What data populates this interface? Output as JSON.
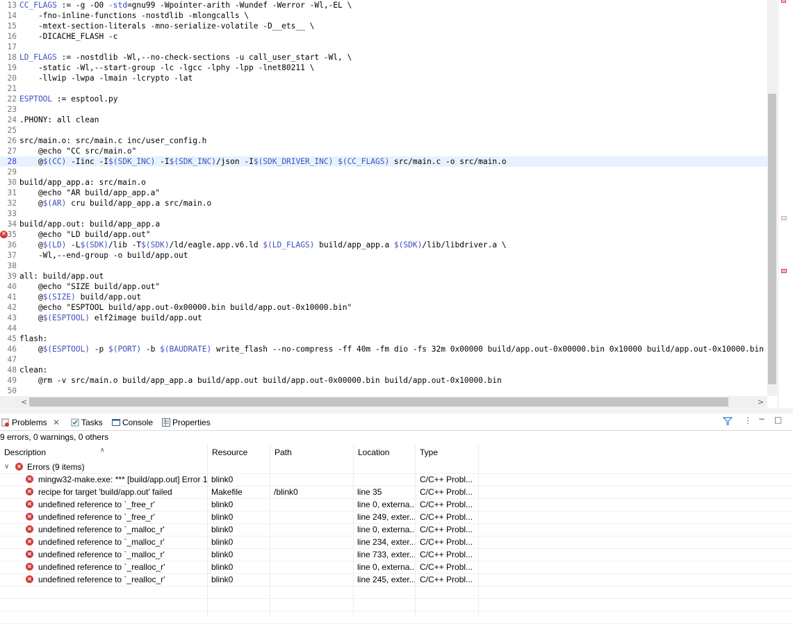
{
  "editor": {
    "lines": [
      {
        "n": "13",
        "segs": [
          [
            "kw",
            "CC_FLAGS"
          ],
          [
            "",
            " := -g -O0 "
          ],
          [
            "kw",
            "-std"
          ],
          [
            "",
            "=gnu99 -Wpointer-arith -Wundef -Werror -Wl,-EL \\"
          ]
        ]
      },
      {
        "n": "14",
        "segs": [
          [
            "",
            "    -fno-inline-functions -nostdlib -mlongcalls \\"
          ]
        ]
      },
      {
        "n": "15",
        "segs": [
          [
            "",
            "    -mtext-section-literals -mno-serialize-volatile -D__ets__ \\"
          ]
        ]
      },
      {
        "n": "16",
        "segs": [
          [
            "",
            "    -DICACHE_FLASH -c"
          ]
        ]
      },
      {
        "n": "17",
        "segs": [
          [
            "",
            ""
          ]
        ]
      },
      {
        "n": "18",
        "segs": [
          [
            "kw",
            "LD_FLAGS"
          ],
          [
            "",
            " := -nostdlib -Wl,--no-check-sections -u call_user_start -Wl, \\"
          ]
        ]
      },
      {
        "n": "19",
        "segs": [
          [
            "",
            "    -static -Wl,--start-group -lc -lgcc -lphy -lpp -lnet80211 \\"
          ]
        ]
      },
      {
        "n": "20",
        "segs": [
          [
            "",
            "    -llwip -lwpa -lmain -lcrypto -lat"
          ]
        ]
      },
      {
        "n": "21",
        "segs": [
          [
            "",
            ""
          ]
        ]
      },
      {
        "n": "22",
        "segs": [
          [
            "kw",
            "ESPTOOL"
          ],
          [
            "",
            " := esptool.py"
          ]
        ]
      },
      {
        "n": "23",
        "segs": [
          [
            "",
            ""
          ]
        ]
      },
      {
        "n": "24",
        "segs": [
          [
            "",
            ".PHONY: all clean"
          ]
        ]
      },
      {
        "n": "25",
        "segs": [
          [
            "",
            ""
          ]
        ]
      },
      {
        "n": "26",
        "segs": [
          [
            "",
            "src/main.o: src/main.c inc/user_config.h"
          ]
        ]
      },
      {
        "n": "27",
        "segs": [
          [
            "",
            "    @echo \"CC src/main.o\""
          ]
        ]
      },
      {
        "n": "28",
        "segs": [
          [
            "",
            "    @"
          ],
          [
            "kw",
            "$(CC)"
          ],
          [
            "",
            " -Iinc -I"
          ],
          [
            "kw",
            "$(SDK_INC)"
          ],
          [
            "",
            " -I"
          ],
          [
            "kw",
            "$(SDK_INC)"
          ],
          [
            "",
            "/json -I"
          ],
          [
            "kw",
            "$(SDK_DRIVER_INC)"
          ],
          [
            "",
            " "
          ],
          [
            "kw",
            "$(CC_FLAGS)"
          ],
          [
            "",
            " src/main.c -o src/main.o"
          ]
        ]
      },
      {
        "n": "29",
        "segs": [
          [
            "",
            ""
          ]
        ]
      },
      {
        "n": "30",
        "segs": [
          [
            "",
            "build/app_app.a: src/main.o"
          ]
        ]
      },
      {
        "n": "31",
        "segs": [
          [
            "",
            "    @echo \"AR build/app_app.a\""
          ]
        ]
      },
      {
        "n": "32",
        "segs": [
          [
            "",
            "    @"
          ],
          [
            "kw",
            "$(AR)"
          ],
          [
            "",
            " cru build/app_app.a src/main.o"
          ]
        ]
      },
      {
        "n": "33",
        "segs": [
          [
            "",
            ""
          ]
        ]
      },
      {
        "n": "34",
        "segs": [
          [
            "",
            "build/app.out: build/app_app.a"
          ]
        ]
      },
      {
        "n": "35",
        "segs": [
          [
            "",
            "    @echo \"LD build/app.out\""
          ]
        ]
      },
      {
        "n": "36",
        "segs": [
          [
            "",
            "    @"
          ],
          [
            "kw",
            "$(LD)"
          ],
          [
            "",
            " -L"
          ],
          [
            "kw",
            "$(SDK)"
          ],
          [
            "",
            "/lib -T"
          ],
          [
            "kw",
            "$(SDK)"
          ],
          [
            "",
            "/ld/eagle.app.v6.ld "
          ],
          [
            "kw",
            "$(LD_FLAGS)"
          ],
          [
            "",
            " build/app_app.a "
          ],
          [
            "kw",
            "$(SDK)"
          ],
          [
            "",
            "/lib/libdriver.a \\"
          ]
        ]
      },
      {
        "n": "37",
        "segs": [
          [
            "",
            "    -Wl,--end-group -o build/app.out"
          ]
        ]
      },
      {
        "n": "38",
        "segs": [
          [
            "",
            ""
          ]
        ]
      },
      {
        "n": "39",
        "segs": [
          [
            "",
            "all: build/app.out"
          ]
        ]
      },
      {
        "n": "40",
        "segs": [
          [
            "",
            "    @echo \"SIZE build/app.out\""
          ]
        ]
      },
      {
        "n": "41",
        "segs": [
          [
            "",
            "    @"
          ],
          [
            "kw",
            "$(SIZE)"
          ],
          [
            "",
            " build/app.out"
          ]
        ]
      },
      {
        "n": "42",
        "segs": [
          [
            "",
            "    @echo \"ESPTOOL build/app.out-0x00000.bin build/app.out-0x10000.bin\""
          ]
        ]
      },
      {
        "n": "43",
        "segs": [
          [
            "",
            "    @"
          ],
          [
            "kw",
            "$(ESPTOOL)"
          ],
          [
            "",
            " elf2image build/app.out"
          ]
        ]
      },
      {
        "n": "44",
        "segs": [
          [
            "",
            ""
          ]
        ]
      },
      {
        "n": "45",
        "segs": [
          [
            "",
            "flash:"
          ]
        ]
      },
      {
        "n": "46",
        "segs": [
          [
            "",
            "    @"
          ],
          [
            "kw",
            "$(ESPTOOL)"
          ],
          [
            "",
            " -p "
          ],
          [
            "kw",
            "$(PORT)"
          ],
          [
            "",
            " -b "
          ],
          [
            "kw",
            "$(BAUDRATE)"
          ],
          [
            "",
            " write_flash --no-compress -ff 40m -fm dio -fs 32m 0x00000 build/app.out-0x00000.bin 0x10000 build/app.out-0x10000.bin"
          ]
        ]
      },
      {
        "n": "47",
        "segs": [
          [
            "",
            ""
          ]
        ]
      },
      {
        "n": "48",
        "segs": [
          [
            "",
            "clean:"
          ]
        ]
      },
      {
        "n": "49",
        "segs": [
          [
            "",
            "    @rm -v src/main.o build/app_app.a build/app.out build/app.out-0x00000.bin build/app.out-0x10000.bin"
          ]
        ]
      },
      {
        "n": "50",
        "segs": [
          [
            "",
            ""
          ]
        ]
      }
    ],
    "current_line": "28",
    "error_line": "35"
  },
  "panel": {
    "tabs": [
      {
        "label": "Problems",
        "icon": "problems-icon"
      },
      {
        "label": "Tasks",
        "icon": "tasks-icon"
      },
      {
        "label": "Console",
        "icon": "console-icon"
      },
      {
        "label": "Properties",
        "icon": "properties-icon"
      }
    ],
    "summary": "9 errors, 0 warnings, 0 others",
    "columns": [
      "Description",
      "Resource",
      "Path",
      "Location",
      "Type"
    ],
    "group_label": "Errors (9 items)",
    "rows": [
      [
        "mingw32-make.exe: *** [build/app.out] Error 1",
        "blink0",
        "",
        "",
        "C/C++ Probl..."
      ],
      [
        "recipe for target 'build/app.out' failed",
        "Makefile",
        "/blink0",
        "line 35",
        "C/C++ Probl..."
      ],
      [
        "undefined reference to `_free_r'",
        "blink0",
        "",
        "line 0, externa...",
        "C/C++ Probl..."
      ],
      [
        "undefined reference to `_free_r'",
        "blink0",
        "",
        "line 249, exter...",
        "C/C++ Probl..."
      ],
      [
        "undefined reference to `_malloc_r'",
        "blink0",
        "",
        "line 0, externa...",
        "C/C++ Probl..."
      ],
      [
        "undefined reference to `_malloc_r'",
        "blink0",
        "",
        "line 234, exter...",
        "C/C++ Probl..."
      ],
      [
        "undefined reference to `_malloc_r'",
        "blink0",
        "",
        "line 733, exter...",
        "C/C++ Probl..."
      ],
      [
        "undefined reference to `_realloc_r'",
        "blink0",
        "",
        "line 0, externa...",
        "C/C++ Probl..."
      ],
      [
        "undefined reference to `_realloc_r'",
        "blink0",
        "",
        "line 245, exter...",
        "C/C++ Probl..."
      ]
    ]
  },
  "colors": {
    "keyword": "#3f4fbf",
    "error": "#d03a3a",
    "highlight": "#e8f2fe"
  }
}
